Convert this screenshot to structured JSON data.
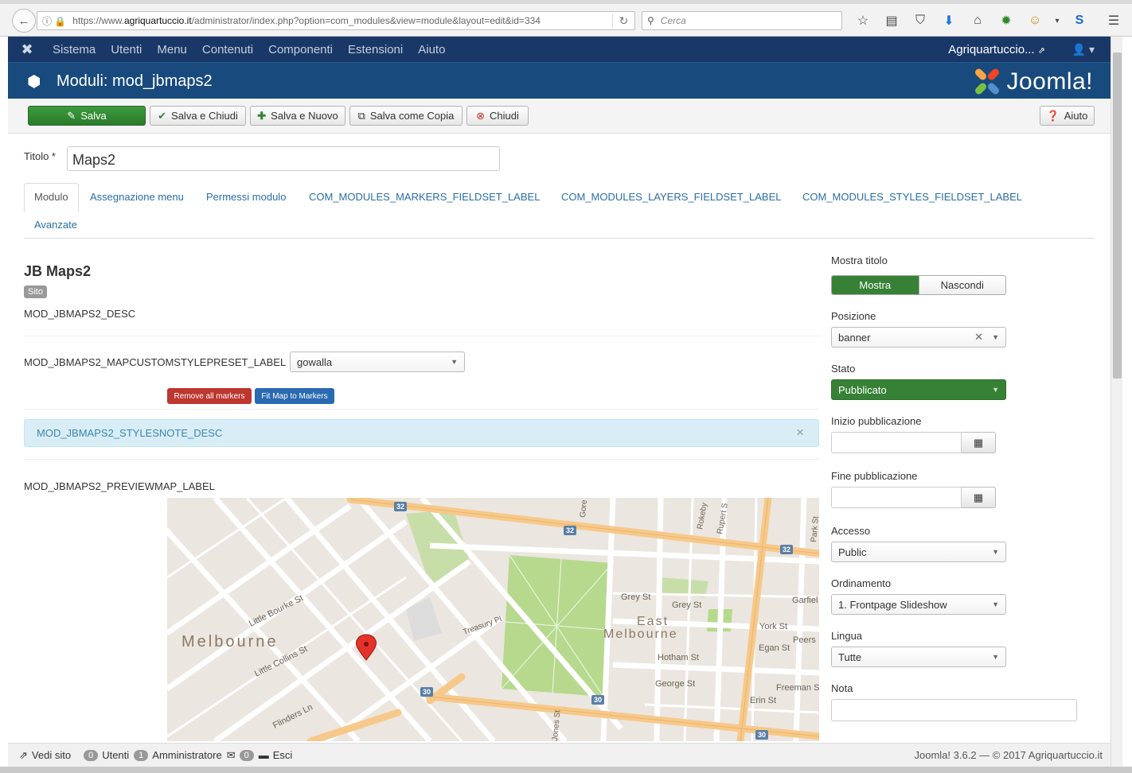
{
  "browser": {
    "url_prefix": "https://www.",
    "url_domain": "agriquartuccio.it",
    "url_path": "/administrator/index.php?option=com_modules&view=module&layout=edit&id=334",
    "search_placeholder": "Cerca"
  },
  "topnav": {
    "items": [
      "Sistema",
      "Utenti",
      "Menu",
      "Contenuti",
      "Componenti",
      "Estensioni",
      "Aiuto"
    ],
    "site_link": "Agriquartuccio...",
    "user_icon": "user-icon"
  },
  "header": {
    "title": "Moduli: mod_jbmaps2",
    "brand": "Joomla!"
  },
  "toolbar": {
    "save": "Salva",
    "save_close": "Salva e Chiudi",
    "save_new": "Salva e Nuovo",
    "save_copy": "Salva come Copia",
    "close": "Chiudi",
    "help": "Aiuto"
  },
  "form": {
    "title_label": "Titolo *",
    "title_value": "Maps2"
  },
  "tabs": [
    "Modulo",
    "Assegnazione menu",
    "Permessi modulo",
    "COM_MODULES_MARKERS_FIELDSET_LABEL",
    "COM_MODULES_LAYERS_FIELDSET_LABEL",
    "COM_MODULES_STYLES_FIELDSET_LABEL",
    "Avanzate"
  ],
  "module": {
    "name": "JB Maps2",
    "badge": "Sito",
    "desc": "MOD_JBMAPS2_DESC",
    "preset_label": "MOD_JBMAPS2_MAPCUSTOMSTYLEPRESET_LABEL",
    "preset_value": "gowalla",
    "remove_markers": "Remove all markers",
    "fit_map": "Fit Map to Markers",
    "styles_note": "MOD_JBMAPS2_STYLESNOTE_DESC",
    "preview_label": "MOD_JBMAPS2_PREVIEWMAP_LABEL"
  },
  "map": {
    "labels": {
      "melbourne": "Melbourne",
      "east_melbourne": "East",
      "east_melbourne_2": "Melbourne",
      "little_bourke": "Little Bourke St",
      "little_collins": "Little Collins St",
      "flinders_ln": "Flinders Ln",
      "treasury": "Treasury Pl",
      "grey_st": "Grey St",
      "grey_st2": "Grey St",
      "hotham": "Hotham St",
      "george": "George St",
      "york": "York St",
      "egan": "Egan St",
      "peers": "Peers",
      "freeman": "Freeman S",
      "erin": "Erin St",
      "garfield": "Garfiel",
      "rokeby": "Rokeby",
      "rupert": "Rupert S",
      "park": "Park St",
      "gore": "Gore",
      "jones": "Jones St"
    },
    "route_badges": [
      "32",
      "32",
      "32",
      "30",
      "30",
      "30"
    ]
  },
  "sidebar": {
    "show_title_label": "Mostra titolo",
    "show": "Mostra",
    "hide": "Nascondi",
    "position_label": "Posizione",
    "position_value": "banner",
    "status_label": "Stato",
    "status_value": "Pubblicato",
    "start_label": "Inizio pubblicazione",
    "end_label": "Fine pubblicazione",
    "access_label": "Accesso",
    "access_value": "Public",
    "ordering_label": "Ordinamento",
    "ordering_value": "1. Frontpage Slideshow",
    "language_label": "Lingua",
    "language_value": "Tutte",
    "note_label": "Nota"
  },
  "status": {
    "view_site": "Vedi sito",
    "users_count": "0",
    "users_label": "Utenti",
    "admin_count": "1",
    "admin_label": "Amministratore",
    "msg_count": "0",
    "logout": "Esci",
    "footer": "Joomla! 3.6.2 — © 2017 Agriquartuccio.it"
  },
  "colors": {
    "nav": "#1a3867",
    "header": "#184a7d",
    "green": "#378137",
    "danger": "#bd362f",
    "primary": "#2a6ab0"
  }
}
